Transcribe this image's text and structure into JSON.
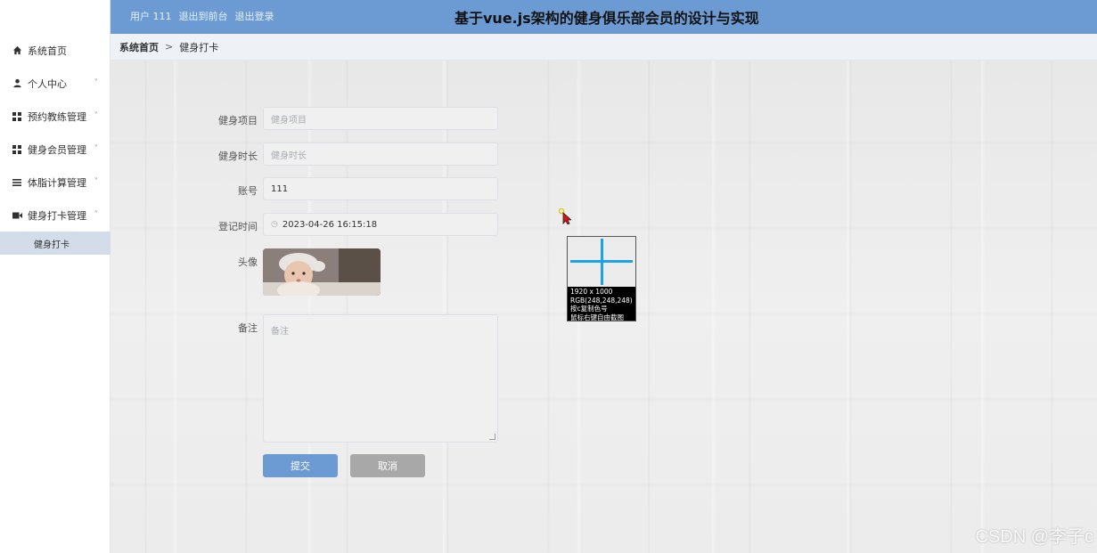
{
  "header": {
    "user_label": "用户 111",
    "back_label": "退出到前台",
    "logout_label": "退出登录",
    "title": "基于vue.js架构的健身俱乐部会员的设计与实现"
  },
  "sidebar": {
    "items": [
      {
        "label": "系统首页",
        "icon": "home-icon"
      },
      {
        "label": "个人中心",
        "icon": "user-icon"
      },
      {
        "label": "预约教练管理",
        "icon": "grid-icon"
      },
      {
        "label": "健身会员管理",
        "icon": "grid-icon"
      },
      {
        "label": "体脂计算管理",
        "icon": "list-icon"
      },
      {
        "label": "健身打卡管理",
        "icon": "video-icon"
      }
    ],
    "sub_item": "健身打卡"
  },
  "breadcrumb": {
    "home": "系统首页",
    "separator": ">",
    "current": "健身打卡"
  },
  "form": {
    "project": {
      "label": "健身项目",
      "placeholder": "健身项目"
    },
    "duration": {
      "label": "健身时长",
      "placeholder": "健身时长"
    },
    "account": {
      "label": "账号",
      "value": "111"
    },
    "time": {
      "label": "登记时间",
      "value": "2023-04-26 16:15:18"
    },
    "avatar": {
      "label": "头像"
    },
    "note": {
      "label": "备注",
      "placeholder": "备注"
    },
    "submit_label": "提交",
    "cancel_label": "取消"
  },
  "picker": {
    "line1": "1920 x 1000",
    "line2": "RGB(248,248,248)",
    "line3": "按c复制色号",
    "line4": "鼠标右键自由截图"
  },
  "watermark": "CSDN @李子c",
  "colors": {
    "header": "#6b9bd2",
    "submit": "#6b9bd2",
    "cancel": "#a8a8a8",
    "active_sub": "#d2dde9"
  }
}
